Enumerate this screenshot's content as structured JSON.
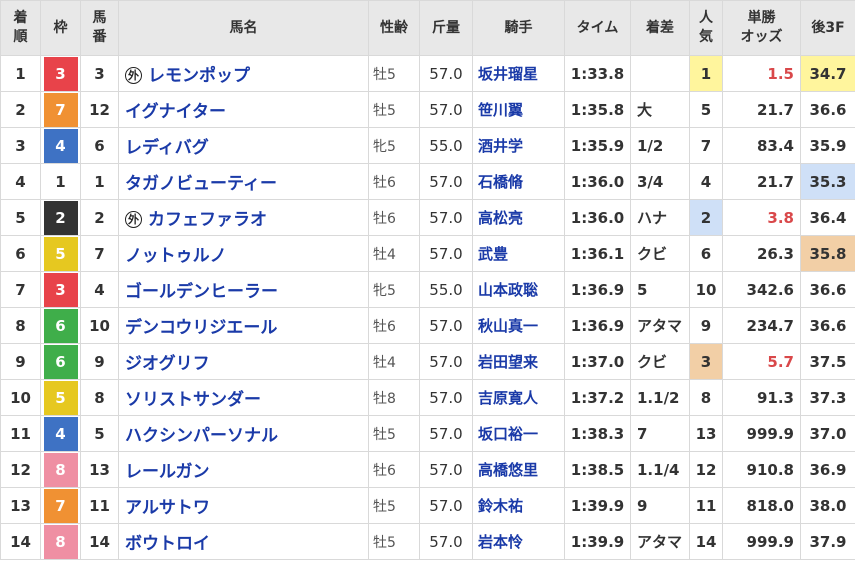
{
  "headers": {
    "rank": [
      "着",
      "順"
    ],
    "frame": "枠",
    "num": [
      "馬",
      "番"
    ],
    "name": "馬名",
    "sex_age": "性齢",
    "weight": "斤量",
    "jockey": "騎手",
    "time": "タイム",
    "margin": "着差",
    "pop": [
      "人",
      "気"
    ],
    "odds": [
      "単勝",
      "オッズ"
    ],
    "last3f": "後3F"
  },
  "gai_mark": "外",
  "frame_colors": {
    "1": {
      "bg": "#ffffff",
      "fg": "#333333"
    },
    "2": {
      "bg": "#333333",
      "fg": "#ffffff"
    },
    "3": {
      "bg": "#e8434a",
      "fg": "#ffffff"
    },
    "4": {
      "bg": "#3e72c4",
      "fg": "#ffffff"
    },
    "5": {
      "bg": "#e6c820",
      "fg": "#ffffff"
    },
    "6": {
      "bg": "#3fae4a",
      "fg": "#ffffff"
    },
    "7": {
      "bg": "#f09133",
      "fg": "#ffffff"
    },
    "8": {
      "bg": "#ef8fa3",
      "fg": "#ffffff"
    }
  },
  "rows": [
    {
      "rank": "1",
      "frame": "3",
      "num": "3",
      "gai": true,
      "name": "レモンポップ",
      "sex_age": "牡5",
      "weight": "57.0",
      "jockey": "坂井瑠星",
      "time": "1:33.8",
      "margin": "",
      "pop": "1",
      "odds": "1.5",
      "last3f": "34.7",
      "pop_hl": "pop1",
      "odds_red": true,
      "last_hl": "last1"
    },
    {
      "rank": "2",
      "frame": "7",
      "num": "12",
      "gai": false,
      "name": "イグナイター",
      "sex_age": "牡5",
      "weight": "57.0",
      "jockey": "笹川翼",
      "time": "1:35.8",
      "margin": "大",
      "pop": "5",
      "odds": "21.7",
      "last3f": "36.6",
      "pop_hl": "",
      "odds_red": false,
      "last_hl": ""
    },
    {
      "rank": "3",
      "frame": "4",
      "num": "6",
      "gai": false,
      "name": "レディバグ",
      "sex_age": "牝5",
      "weight": "55.0",
      "jockey": "酒井学",
      "time": "1:35.9",
      "margin": "1/2",
      "pop": "7",
      "odds": "83.4",
      "last3f": "35.9",
      "pop_hl": "",
      "odds_red": false,
      "last_hl": ""
    },
    {
      "rank": "4",
      "frame": "1",
      "num": "1",
      "gai": false,
      "name": "タガノビューティー",
      "sex_age": "牡6",
      "weight": "57.0",
      "jockey": "石橋脩",
      "time": "1:36.0",
      "margin": "3/4",
      "pop": "4",
      "odds": "21.7",
      "last3f": "35.3",
      "pop_hl": "",
      "odds_red": false,
      "last_hl": "last2"
    },
    {
      "rank": "5",
      "frame": "2",
      "num": "2",
      "gai": true,
      "name": "カフェファラオ",
      "sex_age": "牡6",
      "weight": "57.0",
      "jockey": "高松亮",
      "time": "1:36.0",
      "margin": "ハナ",
      "pop": "2",
      "odds": "3.8",
      "last3f": "36.4",
      "pop_hl": "pop2",
      "odds_red": true,
      "last_hl": ""
    },
    {
      "rank": "6",
      "frame": "5",
      "num": "7",
      "gai": false,
      "name": "ノットゥルノ",
      "sex_age": "牡4",
      "weight": "57.0",
      "jockey": "武豊",
      "time": "1:36.1",
      "margin": "クビ",
      "pop": "6",
      "odds": "26.3",
      "last3f": "35.8",
      "pop_hl": "",
      "odds_red": false,
      "last_hl": "last3"
    },
    {
      "rank": "7",
      "frame": "3",
      "num": "4",
      "gai": false,
      "name": "ゴールデンヒーラー",
      "sex_age": "牝5",
      "weight": "55.0",
      "jockey": "山本政聡",
      "time": "1:36.9",
      "margin": "5",
      "pop": "10",
      "odds": "342.6",
      "last3f": "36.6",
      "pop_hl": "",
      "odds_red": false,
      "last_hl": ""
    },
    {
      "rank": "8",
      "frame": "6",
      "num": "10",
      "gai": false,
      "name": "デンコウリジエール",
      "sex_age": "牡6",
      "weight": "57.0",
      "jockey": "秋山真一",
      "time": "1:36.9",
      "margin": "アタマ",
      "pop": "9",
      "odds": "234.7",
      "last3f": "36.6",
      "pop_hl": "",
      "odds_red": false,
      "last_hl": ""
    },
    {
      "rank": "9",
      "frame": "6",
      "num": "9",
      "gai": false,
      "name": "ジオグリフ",
      "sex_age": "牡4",
      "weight": "57.0",
      "jockey": "岩田望来",
      "time": "1:37.0",
      "margin": "クビ",
      "pop": "3",
      "odds": "5.7",
      "last3f": "37.5",
      "pop_hl": "pop3",
      "odds_red": true,
      "last_hl": ""
    },
    {
      "rank": "10",
      "frame": "5",
      "num": "8",
      "gai": false,
      "name": "ソリストサンダー",
      "sex_age": "牡8",
      "weight": "57.0",
      "jockey": "吉原寛人",
      "time": "1:37.2",
      "margin": "1.1/2",
      "pop": "8",
      "odds": "91.3",
      "last3f": "37.3",
      "pop_hl": "",
      "odds_red": false,
      "last_hl": ""
    },
    {
      "rank": "11",
      "frame": "4",
      "num": "5",
      "gai": false,
      "name": "ハクシンパーソナル",
      "sex_age": "牡5",
      "weight": "57.0",
      "jockey": "坂口裕一",
      "time": "1:38.3",
      "margin": "7",
      "pop": "13",
      "odds": "999.9",
      "last3f": "37.0",
      "pop_hl": "",
      "odds_red": false,
      "last_hl": ""
    },
    {
      "rank": "12",
      "frame": "8",
      "num": "13",
      "gai": false,
      "name": "レールガン",
      "sex_age": "牡6",
      "weight": "57.0",
      "jockey": "高橋悠里",
      "time": "1:38.5",
      "margin": "1.1/4",
      "pop": "12",
      "odds": "910.8",
      "last3f": "36.9",
      "pop_hl": "",
      "odds_red": false,
      "last_hl": ""
    },
    {
      "rank": "13",
      "frame": "7",
      "num": "11",
      "gai": false,
      "name": "アルサトワ",
      "sex_age": "牡5",
      "weight": "57.0",
      "jockey": "鈴木祐",
      "time": "1:39.9",
      "margin": "9",
      "pop": "11",
      "odds": "818.0",
      "last3f": "38.0",
      "pop_hl": "",
      "odds_red": false,
      "last_hl": ""
    },
    {
      "rank": "14",
      "frame": "8",
      "num": "14",
      "gai": false,
      "name": "ボウトロイ",
      "sex_age": "牡5",
      "weight": "57.0",
      "jockey": "岩本怜",
      "time": "1:39.9",
      "margin": "アタマ",
      "pop": "14",
      "odds": "999.9",
      "last3f": "37.9",
      "pop_hl": "",
      "odds_red": false,
      "last_hl": ""
    }
  ]
}
